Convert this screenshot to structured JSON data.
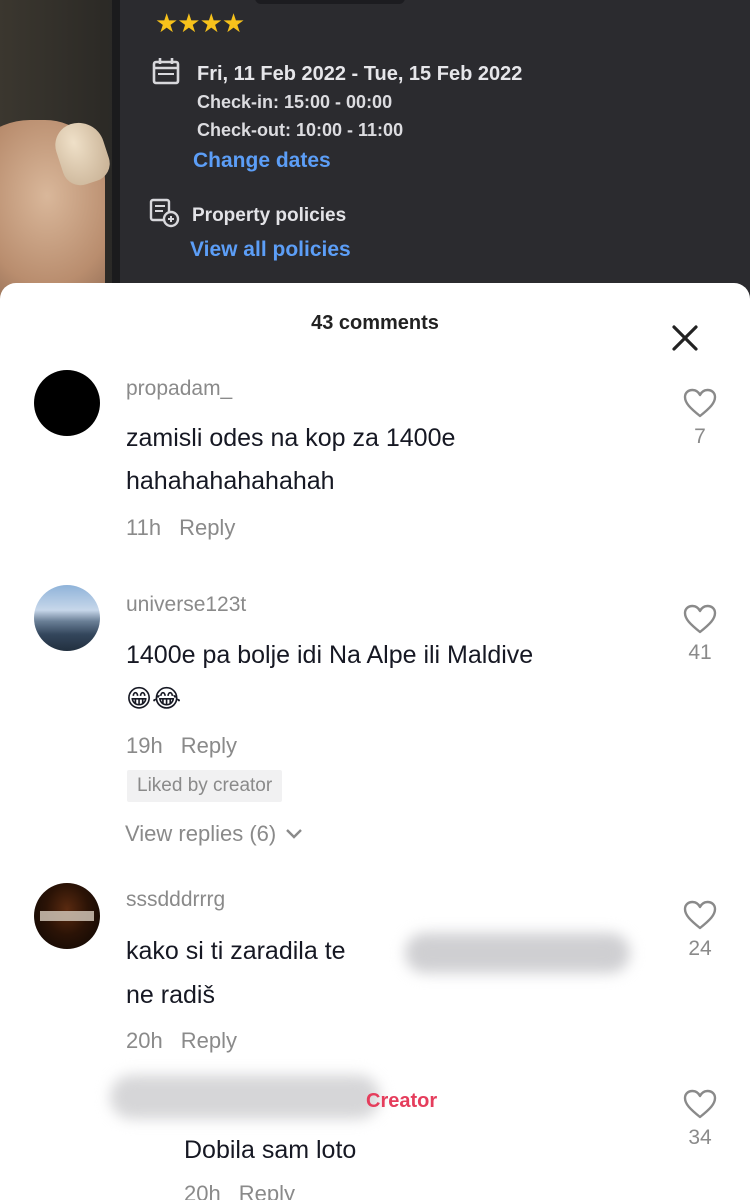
{
  "booking": {
    "stars": "★★★★",
    "dates": "Fri, 11 Feb 2022 - Tue, 15 Feb 2022",
    "check_in": "Check-in: 15:00 - 00:00",
    "check_out": "Check-out: 10:00 - 11:00",
    "change_dates": "Change dates",
    "policies_label": "Property policies",
    "view_all_policies": "View all policies"
  },
  "comments_sheet": {
    "title": "43 comments",
    "comments": [
      {
        "username": "propadam_",
        "text_lines": [
          "zamisli odes na kop za 1400e",
          "hahahahahahahah"
        ],
        "time": "11h",
        "reply": "Reply",
        "likes": "7"
      },
      {
        "username": "universe123t",
        "text_lines": [
          "1400e pa bolje idi Na Alpe ili Maldive",
          "😁😂"
        ],
        "time": "19h",
        "reply": "Reply",
        "likes": "41",
        "liked_by": "Liked by creator",
        "view_replies": "View replies (6)"
      },
      {
        "username": "sssdddrrrg",
        "text_lines": [
          "kako si ti zaradila te",
          "ne radiš"
        ],
        "time": "20h",
        "reply": "Reply",
        "likes": "24"
      },
      {
        "badge": "Creator",
        "text_lines": [
          "Dobila sam loto"
        ],
        "time": "20h",
        "reply": "Reply",
        "likes": "34"
      }
    ]
  },
  "colors": {
    "link_blue": "#5c9ef7",
    "star_yellow": "#f7c21b",
    "creator_red": "#e53d5c"
  }
}
